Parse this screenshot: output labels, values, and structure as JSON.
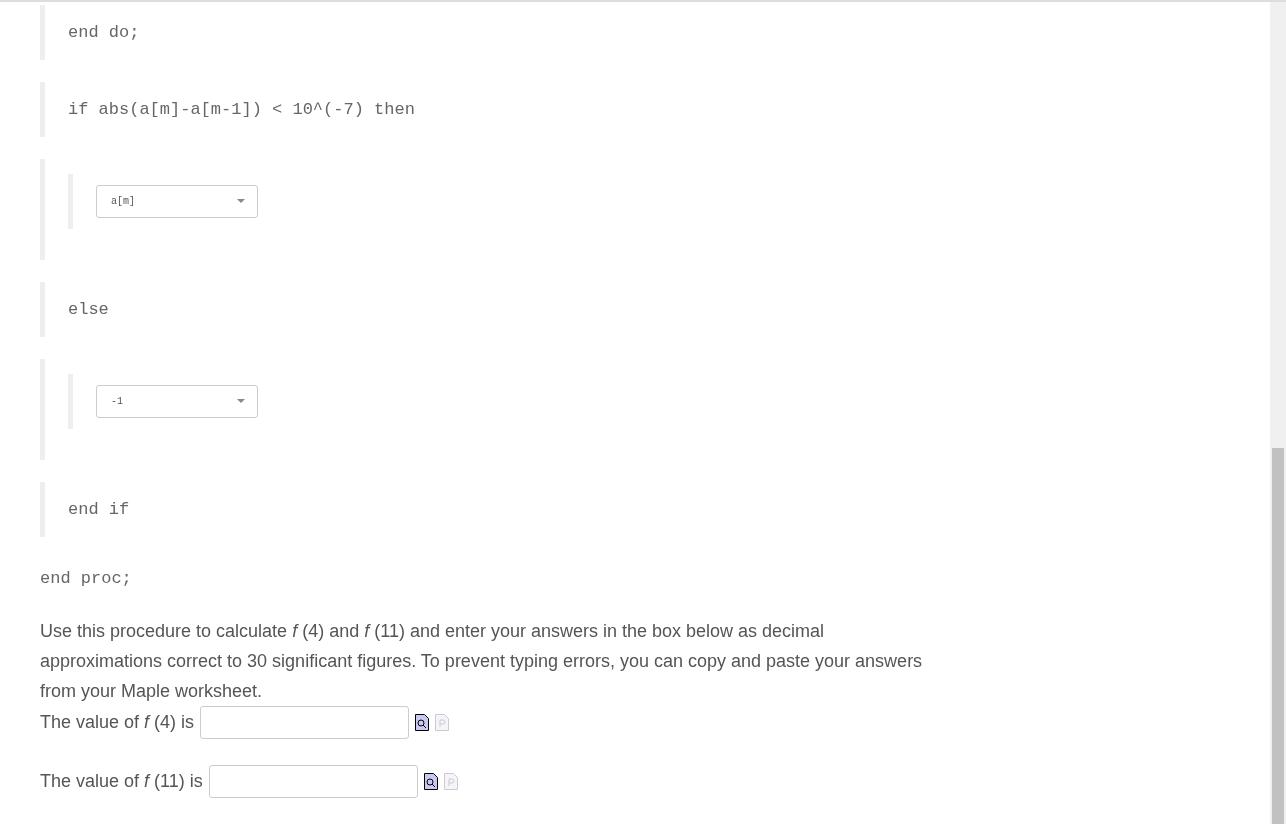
{
  "code": [
    {
      "kind": "line",
      "text": "end do;"
    },
    {
      "kind": "line",
      "text": "if abs(a[m]-a[m-1]) < 10^(-7) then"
    },
    {
      "kind": "dropdown",
      "value": "a[m]"
    },
    {
      "kind": "line",
      "text": "else"
    },
    {
      "kind": "dropdown",
      "value": "-1"
    },
    {
      "kind": "line",
      "text": "end if"
    }
  ],
  "closing": "end proc;",
  "instructions": "Use this procedure to calculate *f* (4) and *f* (11) and enter your answers in the box below as decimal approximations correct to 30 significant figures. To prevent typing errors, you can copy and paste your answers from your Maple worksheet.",
  "answers": [
    {
      "label": "The value of *f* (4) is"
    },
    {
      "label": "The value of *f* (11) is"
    }
  ]
}
